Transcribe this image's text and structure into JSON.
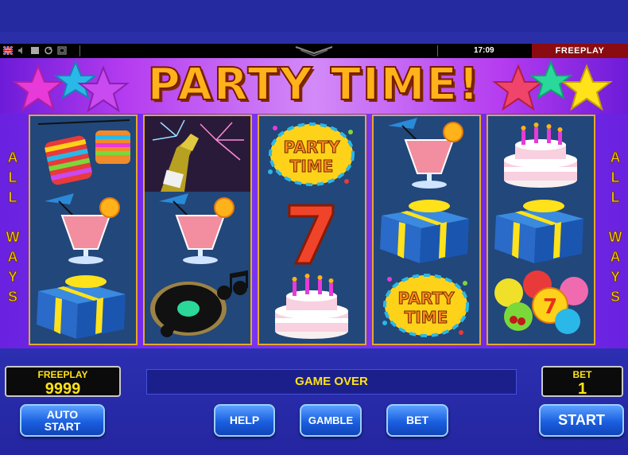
{
  "status_bar": {
    "time": "17:09",
    "mode_label": "FREEPLAY",
    "icons": [
      "uk-flag-icon",
      "sound-icon",
      "window-icon",
      "refresh-icon",
      "fullscreen-icon"
    ]
  },
  "game": {
    "title": "PARTY TIME!",
    "side_left": [
      "A",
      "L",
      "L",
      "W",
      "A",
      "Y",
      "S"
    ],
    "side_right": [
      "A",
      "L",
      "L",
      "W",
      "A",
      "Y",
      "S"
    ]
  },
  "reels": [
    [
      "lanterns",
      "cocktail",
      "gift"
    ],
    [
      "champagne",
      "cocktail",
      "music-record"
    ],
    [
      "party-time-logo",
      "seven",
      "cake"
    ],
    [
      "cocktail",
      "gift",
      "party-time-logo"
    ],
    [
      "cake",
      "gift",
      "balloons"
    ]
  ],
  "symbol_text": {
    "logo_line1": "PARTY",
    "logo_line2": "TIME",
    "seven": "7"
  },
  "credit_panel": {
    "label": "FREEPLAY",
    "value": "9999"
  },
  "bet_panel": {
    "label": "BET",
    "value": "1"
  },
  "message": "GAME OVER",
  "buttons": {
    "auto_start_line1": "AUTO",
    "auto_start_line2": "START",
    "help": "HELP",
    "gamble": "GAMBLE",
    "bet": "BET",
    "start": "START"
  },
  "colors": {
    "accent_gold": "#ffb21a",
    "reel_bg": "#22477a",
    "reel_border": "#e7a82a",
    "button_blue": "#1a5fe0",
    "text_yellow": "#ffe21a"
  }
}
